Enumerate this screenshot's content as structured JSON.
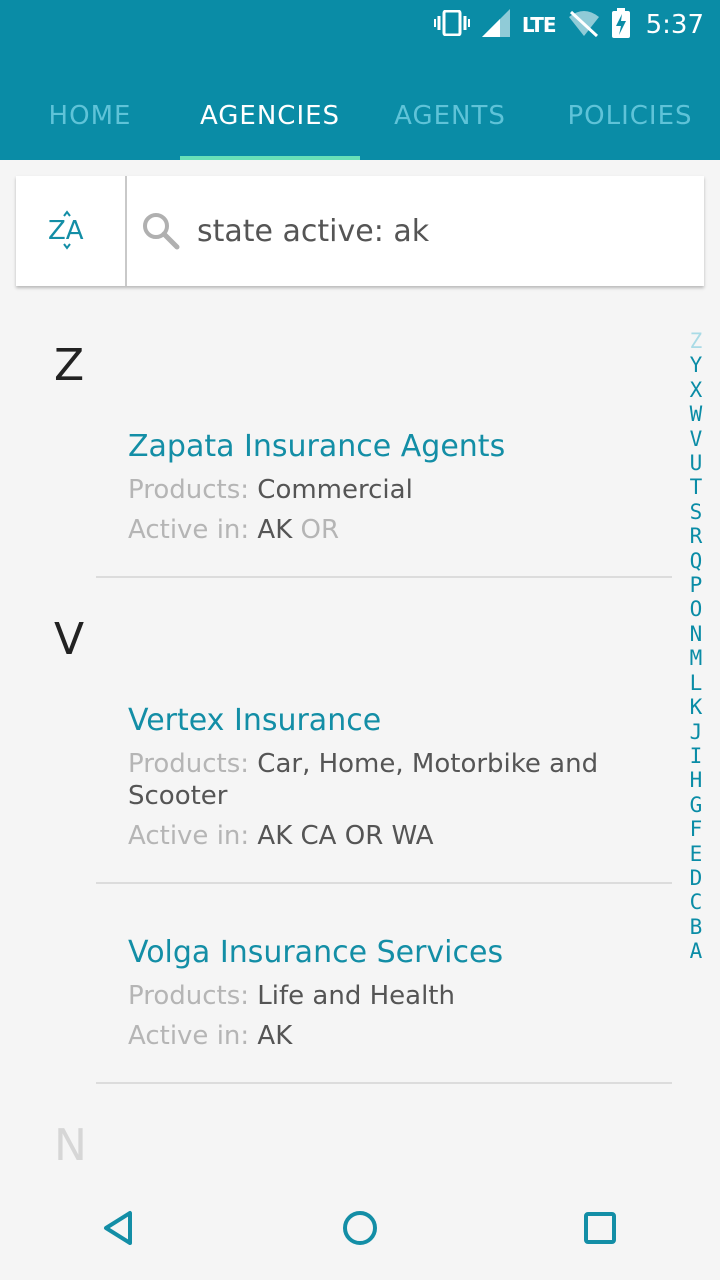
{
  "status": {
    "lte": "LTE",
    "time": "5:37"
  },
  "tabs": [
    {
      "label": "HOME"
    },
    {
      "label": "AGENCIES"
    },
    {
      "label": "AGENTS"
    },
    {
      "label": "POLICIES"
    }
  ],
  "search": {
    "sort_label": "ZA",
    "query": "state active: ak"
  },
  "labels": {
    "products": "Products: ",
    "active_in": "Active in: "
  },
  "sections": [
    {
      "letter": "Z",
      "items": [
        {
          "name": "Zapata Insurance Agents",
          "products": "Commercial",
          "active": "AK",
          "active_extra": "OR"
        }
      ]
    },
    {
      "letter": "V",
      "items": [
        {
          "name": "Vertex Insurance",
          "products": "Car, Home, Motorbike and Scooter",
          "active": "AK CA OR WA",
          "active_extra": ""
        },
        {
          "name": "Volga Insurance Services",
          "products": "Life and Health",
          "active": "AK",
          "active_extra": ""
        }
      ]
    },
    {
      "letter": "N",
      "items": []
    }
  ],
  "alphabet": [
    "Z",
    "Y",
    "X",
    "W",
    "V",
    "U",
    "T",
    "S",
    "R",
    "Q",
    "P",
    "O",
    "N",
    "M",
    "L",
    "K",
    "J",
    "I",
    "H",
    "G",
    "F",
    "E",
    "D",
    "C",
    "B",
    "A"
  ],
  "colors": {
    "primary": "#0a8ca6",
    "tab_indicator": "#68e0b8",
    "link": "#138ea6"
  }
}
